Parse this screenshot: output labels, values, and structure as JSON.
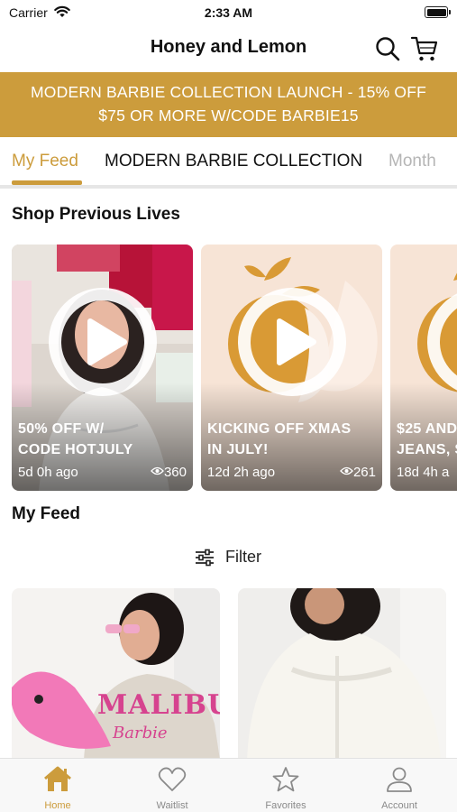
{
  "status_bar": {
    "carrier": "Carrier",
    "time": "2:33 AM"
  },
  "header": {
    "title": "Honey and Lemon"
  },
  "banner": {
    "line1": "MODERN BARBIE COLLECTION LAUNCH - 15% OFF",
    "line2": "$75 OR MORE W/CODE BARBIE15"
  },
  "tabs": [
    {
      "label": "My Feed",
      "active": true
    },
    {
      "label": "MODERN BARBIE COLLECTION"
    },
    {
      "label": "Month"
    }
  ],
  "shop_previous_lives": {
    "title": "Shop Previous Lives",
    "items": [
      {
        "title_line1": "50% OFF W/",
        "title_line2": "CODE HOTJULY",
        "age": "5d 0h ago",
        "views": "360"
      },
      {
        "title_line1": "KICKING OFF XMAS",
        "title_line2": "IN JULY!",
        "age": "12d 2h ago",
        "views": "261"
      },
      {
        "title_line1": "$25 AND",
        "title_line2": "JEANS, S",
        "age": "18d 4h a",
        "views": ""
      }
    ]
  },
  "my_feed": {
    "title": "My Feed",
    "filter_label": "Filter",
    "card1_text": "MALIBU",
    "card1_script": "Barbie"
  },
  "bottom_nav": [
    {
      "label": "Home",
      "icon": "home-icon",
      "active": true
    },
    {
      "label": "Waitlist",
      "icon": "heart-icon"
    },
    {
      "label": "Favorites",
      "icon": "star-icon"
    },
    {
      "label": "Account",
      "icon": "person-icon"
    }
  ],
  "colors": {
    "accent": "#cc9c3c",
    "accent_soft": "#f7e4d6"
  }
}
